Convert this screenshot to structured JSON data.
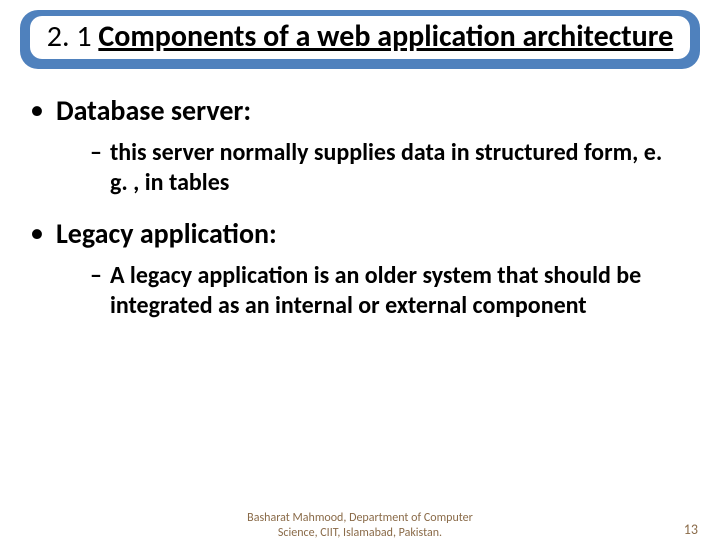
{
  "title": {
    "prefix": "2. 1 ",
    "underlined": "Components of a web application architecture"
  },
  "items": [
    {
      "heading": "Database server:",
      "sub": "this server normally supplies data in structured form, e. g. , in tables"
    },
    {
      "heading": "Legacy application:",
      "sub": "A legacy application is an older system that should be integrated as an internal or external component"
    }
  ],
  "footer": {
    "credit": "Basharat Mahmood, Department of Computer Science, CIIT, Islamabad, Pakistan.",
    "page": "13"
  }
}
